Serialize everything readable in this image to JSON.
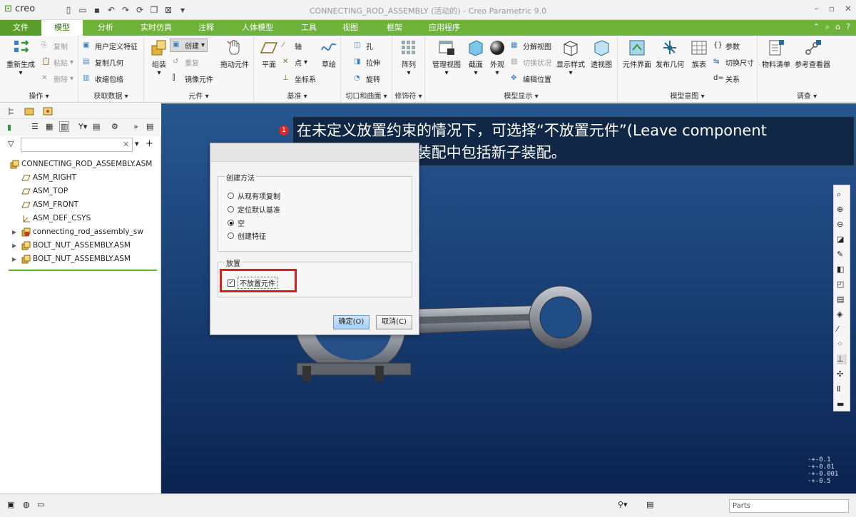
{
  "window": {
    "logo": "creo",
    "title": "CONNECTING_ROD_ASSEMBLY (活动的) - Creo Parametric 9.0"
  },
  "tabs": [
    "文件",
    "模型",
    "分析",
    "实时仿真",
    "注释",
    "人体模型",
    "工具",
    "视图",
    "框架",
    "应用程序"
  ],
  "ribbon": {
    "operations": {
      "regenerate": "重新生成",
      "copy": "复制",
      "paste": "粘贴",
      "delete": "删除",
      "group": "操作"
    },
    "get_data": {
      "udf": "用户定义特征",
      "copy_geom": "复制几何",
      "shrinkwrap": "收缩包络",
      "group": "获取数据"
    },
    "component": {
      "assemble": "组装",
      "create": "创建",
      "repeat": "重复",
      "mirror": "镜像元件",
      "drag": "拖动元件",
      "group": "元件"
    },
    "datum": {
      "plane": "平面",
      "axis": "轴",
      "point": "点",
      "csys": "坐标系",
      "sketch": "草绘",
      "group": "基准"
    },
    "cut_surface": {
      "hole": "孔",
      "extrude": "拉伸",
      "revolve": "旋转",
      "group": "切口和曲面"
    },
    "modifiers": {
      "pattern": "阵列",
      "group": "修饰符"
    },
    "model_display": {
      "manage_views": "管理视图",
      "section": "截面",
      "appearance": "外观",
      "explode": "分解视图",
      "toggle": "切换状况",
      "edit_pos": "编辑位置",
      "display_style": "显示样式",
      "perspective": "透视图",
      "group": "模型显示"
    },
    "model_intent": {
      "comp_interface": "元件界面",
      "publish_geom": "发布几何",
      "family_table": "族表",
      "params": "参数",
      "switch_dims": "切换尺寸",
      "relations": "关系",
      "group": "模型意图"
    },
    "investigate": {
      "bom": "物料清单",
      "ref_viewer": "参考查看器",
      "group": "调查"
    }
  },
  "tree": {
    "filter_placeholder": "",
    "items": [
      {
        "label": "CONNECTING_ROD_ASSEMBLY.ASM",
        "icon": "assembly-icon",
        "expandable": false,
        "indent": 0
      },
      {
        "label": "ASM_RIGHT",
        "icon": "datum-plane-icon",
        "expandable": false,
        "indent": 1
      },
      {
        "label": "ASM_TOP",
        "icon": "datum-plane-icon",
        "expandable": false,
        "indent": 1
      },
      {
        "label": "ASM_FRONT",
        "icon": "datum-plane-icon",
        "expandable": false,
        "indent": 1
      },
      {
        "label": "ASM_DEF_CSYS",
        "icon": "csys-icon",
        "expandable": false,
        "indent": 1
      },
      {
        "label": "connecting_rod_assembly_sw",
        "icon": "subassembly-icon",
        "expandable": true,
        "indent": 1
      },
      {
        "label": "BOLT_NUT_ASSEMBLY.ASM",
        "icon": "assembly-icon",
        "expandable": true,
        "indent": 1
      },
      {
        "label": "BOLT_NUT_ASSEMBLY.ASM",
        "icon": "assembly-icon",
        "expandable": true,
        "indent": 1
      }
    ]
  },
  "callout": {
    "number": "1",
    "text": "在未定义放置约束的情况下，可选择“不放置元件”(Leave component unplaced)，以在装配中包括新子装配。"
  },
  "dialog": {
    "method_label": "创建方法",
    "options": [
      {
        "label": "从现有项复制",
        "selected": false
      },
      {
        "label": "定位默认基准",
        "selected": false
      },
      {
        "label": "空",
        "selected": true
      },
      {
        "label": "创建特征",
        "selected": false
      }
    ],
    "placement_label": "放置",
    "unplaced_label": "不放置元件",
    "unplaced_checked": true,
    "ok": "确定(O)",
    "cancel": "取消(C)"
  },
  "readout": [
    "·+-0.1",
    "·+-0.01",
    "·+-0.001",
    "·+-0.5"
  ],
  "statusbar": {
    "filter": "Parts"
  },
  "colors": {
    "tab_green": "#6fb23a",
    "highlight_red": "#d62020",
    "viewport_top": "#27578f",
    "viewport_bottom": "#0b2350"
  }
}
